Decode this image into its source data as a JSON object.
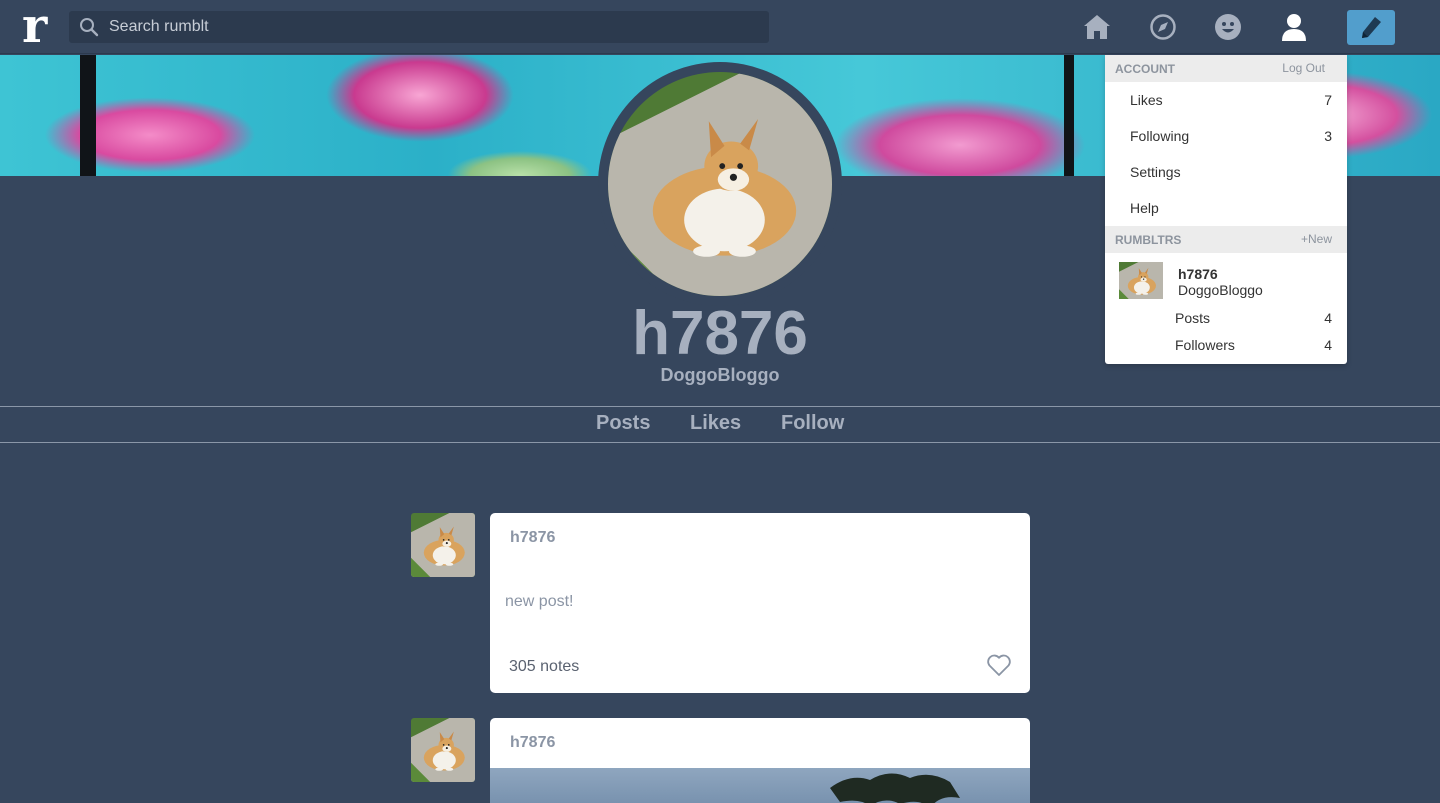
{
  "app": {
    "logo_letter": "r",
    "search_placeholder": "Search rumblt"
  },
  "nav": {
    "icons": [
      "home-icon",
      "compass-icon",
      "smiley-icon",
      "user-icon",
      "pencil-icon"
    ]
  },
  "blog": {
    "name": "h7876",
    "title": "DoggoBloggo"
  },
  "tabs": [
    {
      "label": "Posts"
    },
    {
      "label": "Likes"
    },
    {
      "label": "Follow"
    }
  ],
  "posts": [
    {
      "author": "h7876",
      "text": "new post!",
      "notes": "305 notes"
    },
    {
      "author": "h7876"
    }
  ],
  "dropdown": {
    "account_label": "ACCOUNT",
    "logout_label": "Log Out",
    "items": [
      {
        "label": "Likes",
        "count": "7"
      },
      {
        "label": "Following",
        "count": "3"
      },
      {
        "label": "Settings",
        "count": ""
      },
      {
        "label": "Help",
        "count": ""
      }
    ],
    "rumbltrs_label": "RUMBLTRS",
    "new_label": "+New",
    "blog": {
      "name": "h7876",
      "title": "DoggoBloggo",
      "stats": [
        {
          "label": "Posts",
          "count": "4"
        },
        {
          "label": "Followers",
          "count": "4"
        }
      ]
    }
  },
  "colors": {
    "background": "#36465d",
    "accent": "#529ecc"
  }
}
